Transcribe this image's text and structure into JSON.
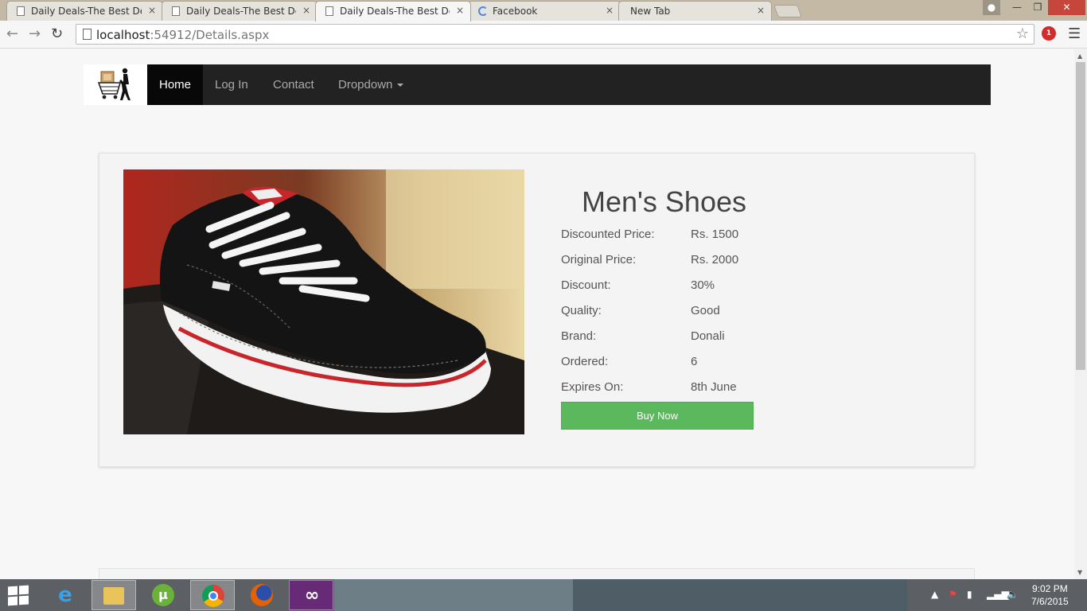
{
  "browser": {
    "tabs": [
      {
        "label": "Daily Deals-The Best Deal",
        "active": false,
        "icon": "page-icon"
      },
      {
        "label": "Daily Deals-The Best Deal",
        "active": false,
        "icon": "page-icon"
      },
      {
        "label": "Daily Deals-The Best Deal",
        "active": true,
        "icon": "page-icon"
      },
      {
        "label": "Facebook",
        "active": false,
        "icon": "loading-spinner-icon"
      },
      {
        "label": "New Tab",
        "active": false,
        "icon": "none"
      }
    ],
    "close_glyph": "×",
    "url_host": "localhost",
    "url_path": ":54912/Details.aspx",
    "extension_badge": "1"
  },
  "navbar": {
    "items": [
      {
        "label": "Home",
        "active": true
      },
      {
        "label": "Log In",
        "active": false
      },
      {
        "label": "Contact",
        "active": false
      },
      {
        "label": "Dropdown",
        "active": false
      }
    ]
  },
  "product": {
    "title": "Men's Shoes",
    "details": [
      {
        "label": "Discounted Price:",
        "value": "Rs. 1500"
      },
      {
        "label": "Original Price:",
        "value": "Rs. 2000"
      },
      {
        "label": "Discount:",
        "value": "30%"
      },
      {
        "label": "Quality:",
        "value": "Good"
      },
      {
        "label": "Brand:",
        "value": "Donali"
      },
      {
        "label": "Ordered:",
        "value": "6"
      },
      {
        "label": "Expires On:",
        "value": "8th June"
      }
    ],
    "buy_label": "Buy Now",
    "buy_color": "#5cb85c"
  },
  "taskbar": {
    "apps": [
      "internet-explorer-icon",
      "file-explorer-icon",
      "utorrent-icon",
      "chrome-icon",
      "firefox-icon",
      "visual-studio-icon"
    ],
    "active_app": "chrome-icon",
    "time": "9:02 PM",
    "date": "7/6/2015"
  }
}
